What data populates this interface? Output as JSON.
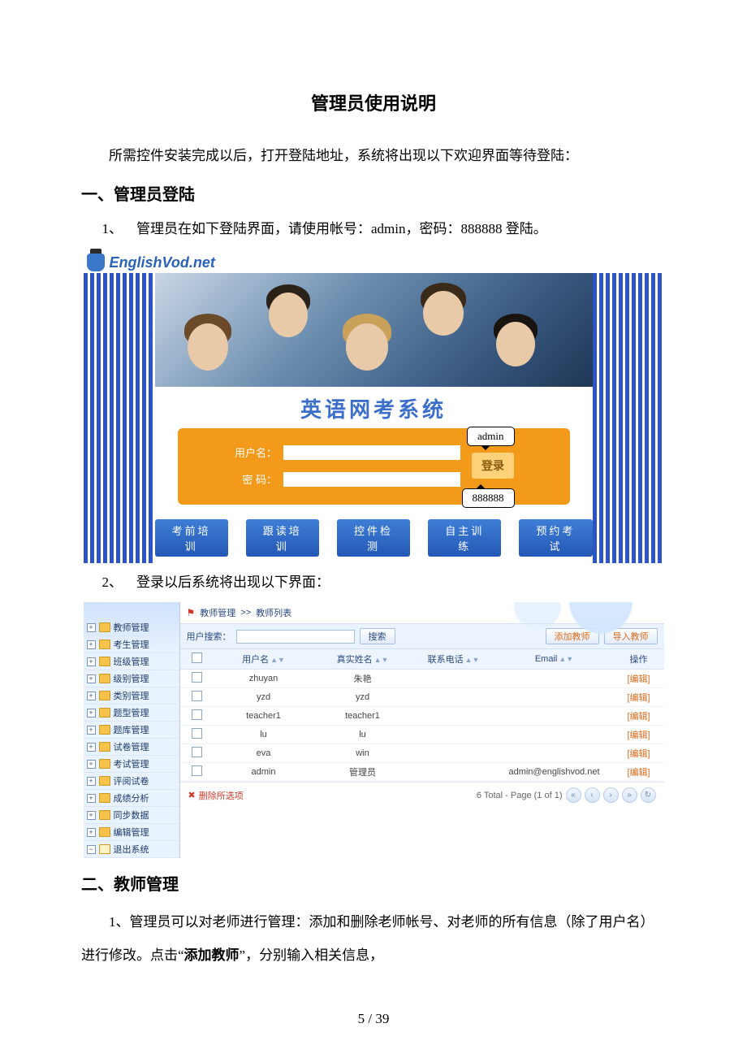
{
  "doc": {
    "title": "管理员使用说明",
    "intro": "所需控件安装完成以后，打开登陆地址，系统将出现以下欢迎界面等待登陆：",
    "section1_heading": "一、管理员登陆",
    "section1_item1": "1、 管理员在如下登陆界面，请使用帐号：admin，密码：888888 登陆。",
    "section1_item2": "2、 登录以后系统将出现以下界面：",
    "section2_heading": "二、教师管理",
    "section2_p1a": "1、管理员可以对老师进行管理：添加和删除老师帐号、对老师的所有信息（除了用户名）进行修改。点击“",
    "section2_p1b": "添加教师",
    "section2_p1c": "”，分别输入相关信息，",
    "page_number": "5 / 39"
  },
  "login": {
    "logo_text": "EnglishVod.net",
    "system_title": "英语网考系统",
    "user_label": "用户名：",
    "pass_label": "密 码：",
    "login_btn": "登录",
    "callout_user": "admin",
    "callout_pass": "888888",
    "nav": [
      "考前培训",
      "跟读培训",
      "控件检测",
      "自主训练",
      "预约考试"
    ]
  },
  "admin": {
    "breadcrumb_a": "教师管理",
    "breadcrumb_sep": ">>",
    "breadcrumb_b": "教师列表",
    "search_label": "用户搜索：",
    "search_btn": "搜索",
    "add_btn": "添加教师",
    "import_btn": "导入教师",
    "sidebar": [
      "教师管理",
      "考生管理",
      "班级管理",
      "级别管理",
      "类别管理",
      "题型管理",
      "题库管理",
      "试卷管理",
      "考试管理",
      "评阅试卷",
      "成绩分析",
      "同步数据",
      "编辑管理",
      "退出系统"
    ],
    "columns": [
      "",
      "用户名",
      "真实姓名",
      "联系电话",
      "Email",
      "操作"
    ],
    "rows": [
      {
        "user": "zhuyan",
        "name": "朱艳",
        "tel": "",
        "email": "",
        "op": "[编辑]"
      },
      {
        "user": "yzd",
        "name": "yzd",
        "tel": "",
        "email": "",
        "op": "[编辑]"
      },
      {
        "user": "teacher1",
        "name": "teacher1",
        "tel": "",
        "email": "",
        "op": "[编辑]"
      },
      {
        "user": "lu",
        "name": "lu",
        "tel": "",
        "email": "",
        "op": "[编辑]"
      },
      {
        "user": "eva",
        "name": "win",
        "tel": "",
        "email": "",
        "op": "[编辑]"
      },
      {
        "user": "admin",
        "name": "管理员",
        "tel": "",
        "email": "admin@englishvod.net",
        "op": "[编辑]"
      }
    ],
    "delete_sel": "删除所选项",
    "pager_text": "6 Total - Page (1 of 1)"
  }
}
